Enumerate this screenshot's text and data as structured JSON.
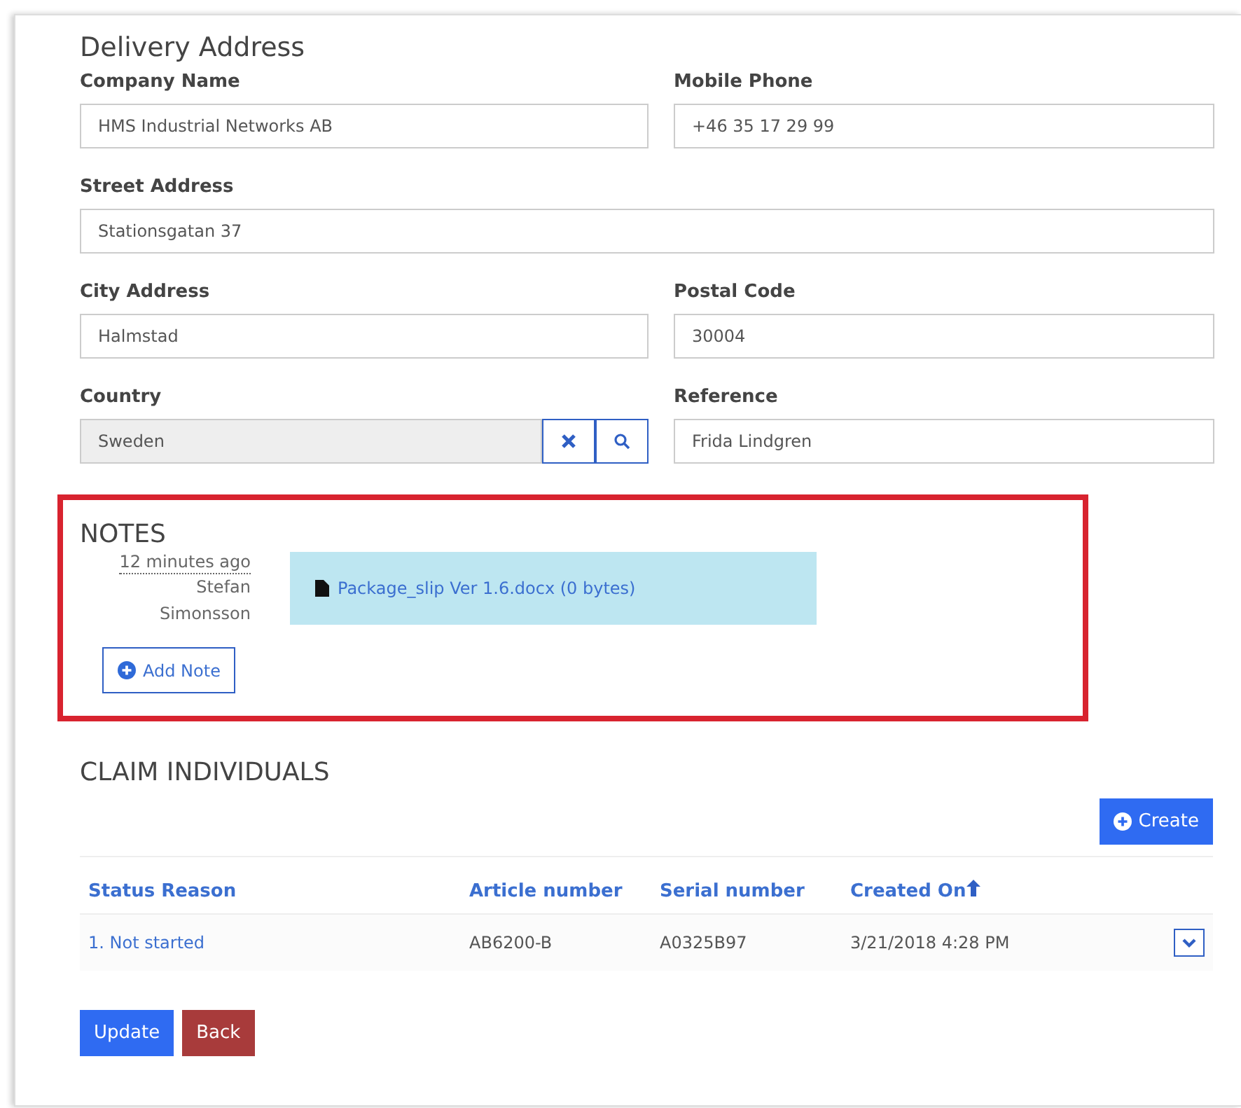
{
  "delivery_address": {
    "title": "Delivery Address",
    "fields": [
      {
        "label": "Company Name",
        "value": "HMS Industrial Networks AB",
        "kind": "text",
        "disabled": false
      },
      {
        "label": "Mobile Phone",
        "value": "+46 35 17 29 99",
        "kind": "text",
        "disabled": false
      },
      {
        "label": "Street Address",
        "value": "Stationsgatan 37",
        "kind": "wide",
        "disabled": false
      },
      {
        "label": "City Address",
        "value": "Halmstad",
        "kind": "text",
        "disabled": false
      },
      {
        "label": "Postal Code",
        "value": "30004",
        "kind": "text",
        "disabled": false
      },
      {
        "label": "Country",
        "value": "Sweden",
        "kind": "lookup",
        "disabled": true
      },
      {
        "label": "Reference",
        "value": "Frida Lindgren",
        "kind": "text",
        "disabled": false
      }
    ]
  },
  "notes": {
    "title": "NOTES",
    "highlighted": true,
    "items": [
      {
        "time": "12 minutes ago",
        "author": "Stefan Simonsson",
        "attachment": "Package_slip Ver 1.6.docx (0 bytes)"
      }
    ],
    "add_button": "Add Note"
  },
  "claim_individuals": {
    "title": "CLAIM INDIVIDUALS",
    "create_button": "Create",
    "columns": [
      {
        "label": "Status Reason",
        "sorted": false
      },
      {
        "label": "Article number",
        "sorted": false
      },
      {
        "label": "Serial number",
        "sorted": false
      },
      {
        "label": "Created On",
        "sorted": true
      }
    ],
    "rows": [
      {
        "cells": [
          "1. Not started",
          "AB6200-B",
          "A0325B97",
          "3/21/2018 4:28 PM"
        ]
      }
    ]
  },
  "buttons": [
    {
      "label": "Update",
      "kind": "primary"
    },
    {
      "label": "Back",
      "kind": "danger"
    }
  ]
}
